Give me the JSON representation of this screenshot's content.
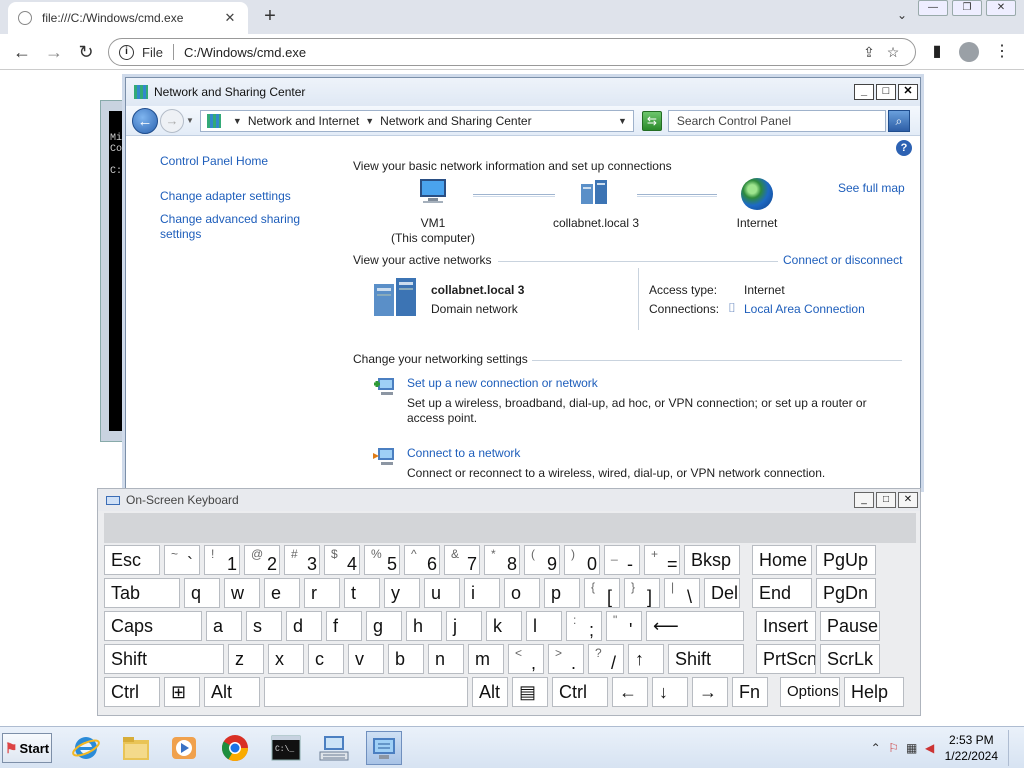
{
  "browser": {
    "tab_title": "file:///C:/Windows/cmd.exe",
    "scheme_label": "File",
    "url": "C:/Windows/cmd.exe",
    "new_tab": "+",
    "tab_close": "✕"
  },
  "cmd": {
    "text": "Mi\nCo\n\nC:"
  },
  "nsc": {
    "title": "Network and Sharing Center",
    "breadcrumb": [
      "Network and Internet",
      "Network and Sharing Center"
    ],
    "search_placeholder": "Search Control Panel",
    "help": "?",
    "left_links": [
      "Control Panel Home",
      "Change adapter settings",
      "Change advanced sharing settings"
    ],
    "basic_heading": "View your basic network information and set up connections",
    "see_full_map": "See full map",
    "map_nodes": [
      {
        "label": "VM1",
        "sub": "(This computer)"
      },
      {
        "label": "collabnet.local  3",
        "sub": ""
      },
      {
        "label": "Internet",
        "sub": ""
      }
    ],
    "active_heading": "View your active networks",
    "connect_disconnect": "Connect or disconnect",
    "network_name": "collabnet.local  3",
    "network_type": "Domain network",
    "access_type_label": "Access type:",
    "access_type_value": "Internet",
    "connections_label": "Connections:",
    "connections_value": "Local Area Connection",
    "change_heading": "Change your networking settings",
    "tasks": [
      {
        "link": "Set up a new connection or network",
        "desc": "Set up a wireless, broadband, dial-up, ad hoc, or VPN connection; or set up a router or access point."
      },
      {
        "link": "Connect to a network",
        "desc": "Connect or reconnect to a wireless, wired, dial-up, or VPN network connection."
      }
    ]
  },
  "osk": {
    "title": "On-Screen Keyboard",
    "rows": [
      [
        {
          "k": "Esc",
          "w": 58
        },
        {
          "k": "` ~",
          "shift": "~",
          "low": "`",
          "w": 38
        },
        {
          "shift": "!",
          "low": "1",
          "w": 38
        },
        {
          "shift": "@",
          "low": "2",
          "w": 38
        },
        {
          "shift": "#",
          "low": "3",
          "w": 38
        },
        {
          "shift": "$",
          "low": "4",
          "w": 38
        },
        {
          "shift": "%",
          "low": "5",
          "w": 38
        },
        {
          "shift": "^",
          "low": "6",
          "w": 38
        },
        {
          "shift": "&",
          "low": "7",
          "w": 38
        },
        {
          "shift": "*",
          "low": "8",
          "w": 38
        },
        {
          "shift": "(",
          "low": "9",
          "w": 38
        },
        {
          "shift": ")",
          "low": "0",
          "w": 38
        },
        {
          "shift": "_",
          "low": "-",
          "w": 38
        },
        {
          "shift": "+",
          "low": "=",
          "w": 38
        },
        {
          "k": "Bksp",
          "w": 58
        },
        {
          "gap": 8
        },
        {
          "k": "Home",
          "w": 62
        },
        {
          "k": "PgUp",
          "w": 62
        }
      ],
      [
        {
          "k": "Tab",
          "w": 78
        },
        {
          "k": "q",
          "w": 38
        },
        {
          "k": "w",
          "w": 38
        },
        {
          "k": "e",
          "w": 38
        },
        {
          "k": "r",
          "w": 38
        },
        {
          "k": "t",
          "w": 38
        },
        {
          "k": "y",
          "w": 38
        },
        {
          "k": "u",
          "w": 38
        },
        {
          "k": "i",
          "w": 38
        },
        {
          "k": "o",
          "w": 38
        },
        {
          "k": "p",
          "w": 38
        },
        {
          "shift": "{",
          "low": "[",
          "w": 38
        },
        {
          "shift": "}",
          "low": "]",
          "w": 38
        },
        {
          "shift": "|",
          "low": "\\",
          "w": 38
        },
        {
          "k": "Del",
          "w": 38
        },
        {
          "gap": 8
        },
        {
          "k": "End",
          "w": 62
        },
        {
          "k": "PgDn",
          "w": 62
        }
      ],
      [
        {
          "k": "Caps",
          "w": 100
        },
        {
          "k": "a",
          "w": 38
        },
        {
          "k": "s",
          "w": 38
        },
        {
          "k": "d",
          "w": 38
        },
        {
          "k": "f",
          "w": 38
        },
        {
          "k": "g",
          "w": 38
        },
        {
          "k": "h",
          "w": 38
        },
        {
          "k": "j",
          "w": 38
        },
        {
          "k": "k",
          "w": 38
        },
        {
          "k": "l",
          "w": 38
        },
        {
          "shift": ":",
          "low": ";",
          "w": 38
        },
        {
          "shift": "\"",
          "low": "'",
          "w": 38
        },
        {
          "k": "⟵",
          "w": 100
        },
        {
          "gap": 8
        },
        {
          "k": "Insert",
          "w": 62
        },
        {
          "k": "Pause",
          "w": 62
        }
      ],
      [
        {
          "k": "Shift",
          "w": 122
        },
        {
          "k": "z",
          "w": 38
        },
        {
          "k": "x",
          "w": 38
        },
        {
          "k": "c",
          "w": 38
        },
        {
          "k": "v",
          "w": 38
        },
        {
          "k": "b",
          "w": 38
        },
        {
          "k": "n",
          "w": 38
        },
        {
          "k": "m",
          "w": 38
        },
        {
          "shift": "<",
          "low": ",",
          "w": 38
        },
        {
          "shift": ">",
          "low": ".",
          "w": 38
        },
        {
          "shift": "?",
          "low": "/",
          "w": 38
        },
        {
          "k": "↑",
          "w": 38
        },
        {
          "k": "Shift",
          "w": 78
        },
        {
          "gap": 8
        },
        {
          "k": "PrtScn",
          "w": 62
        },
        {
          "k": "ScrLk",
          "w": 62
        }
      ],
      [
        {
          "k": "Ctrl",
          "w": 58
        },
        {
          "k": "⊞",
          "w": 38
        },
        {
          "k": "Alt",
          "w": 58
        },
        {
          "k": "",
          "w": 206
        },
        {
          "k": "Alt",
          "w": 38
        },
        {
          "k": "▤",
          "w": 38
        },
        {
          "k": "Ctrl",
          "w": 58
        },
        {
          "k": "←",
          "w": 38
        },
        {
          "k": "↓",
          "w": 38
        },
        {
          "k": "→",
          "w": 38
        },
        {
          "k": "Fn",
          "w": 38
        },
        {
          "gap": 8
        },
        {
          "k": "Options",
          "w": 62,
          "small": true
        },
        {
          "k": "Help",
          "w": 62
        }
      ]
    ]
  },
  "taskbar": {
    "start_label": "Start",
    "time": "2:53 PM",
    "date": "1/22/2024"
  },
  "colors": {
    "link": "#1e5ebb",
    "window_border": "#7b8fa9"
  }
}
